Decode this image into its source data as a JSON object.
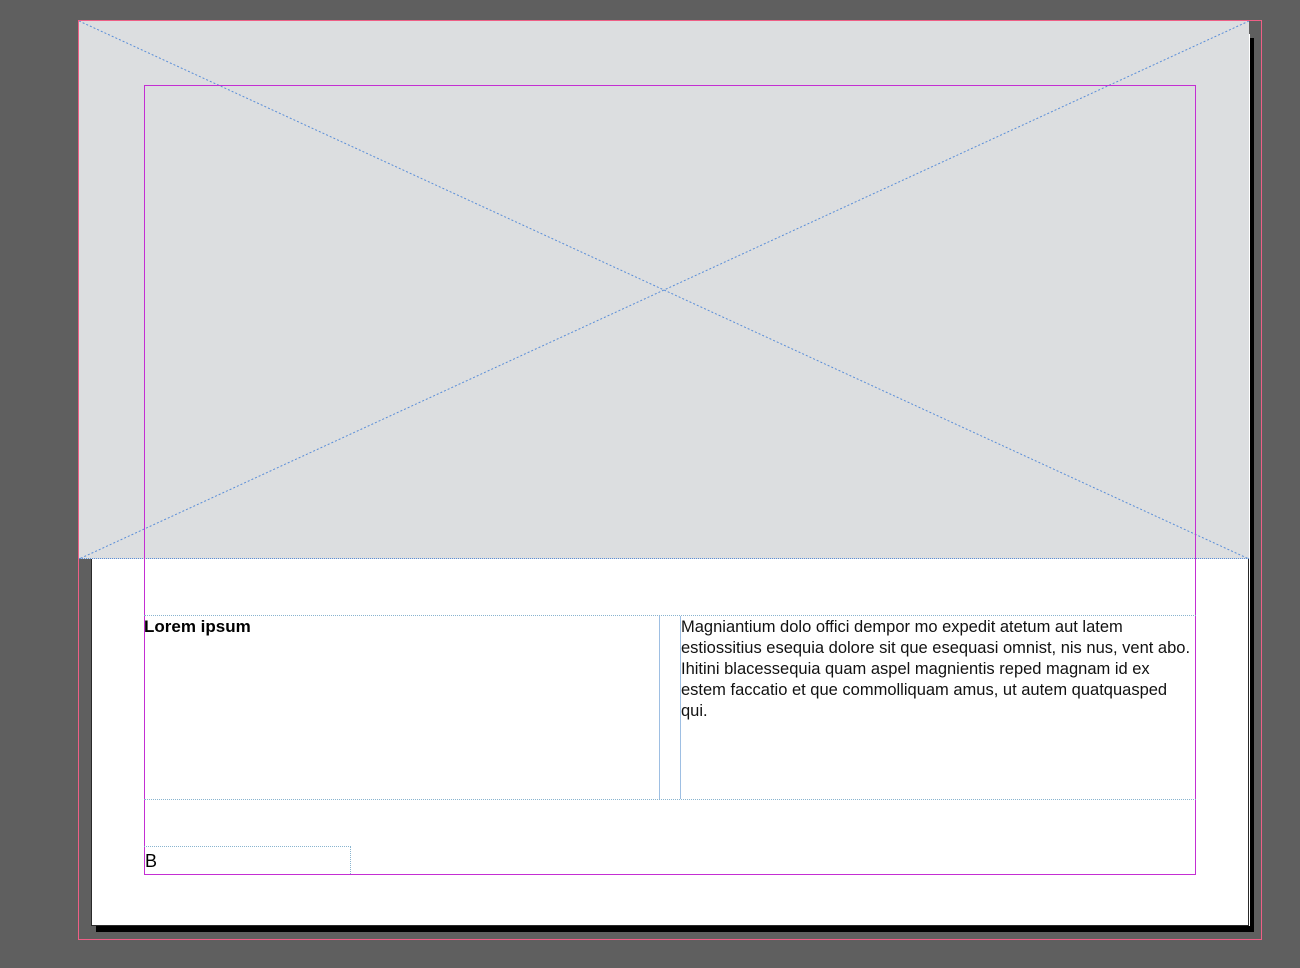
{
  "document": {
    "heading": "Lorem ipsum",
    "body": "Magniantium dolo offici dempor mo expedit atetum aut latem estiossitius esequia dolore sit que esequasi omnist, nis nus, vent abo. Ihitini blacessequia quam aspel magnientis reped magnam id ex estem faccatio et que commolliquam amus, ut autem quatquasped qui.",
    "footer_label": "B"
  },
  "colors": {
    "pasteboard": "#5f5f5f",
    "page": "#ffffff",
    "image_placeholder": "#dcdee0",
    "placeholder_cross": "#5a8ed8",
    "margin_guide": "#c42ed3",
    "bleed_guide": "#ee5f86",
    "frame_guide": "#89b4cf"
  },
  "icons": {
    "image_placeholder": "image-placeholder-cross-icon"
  }
}
